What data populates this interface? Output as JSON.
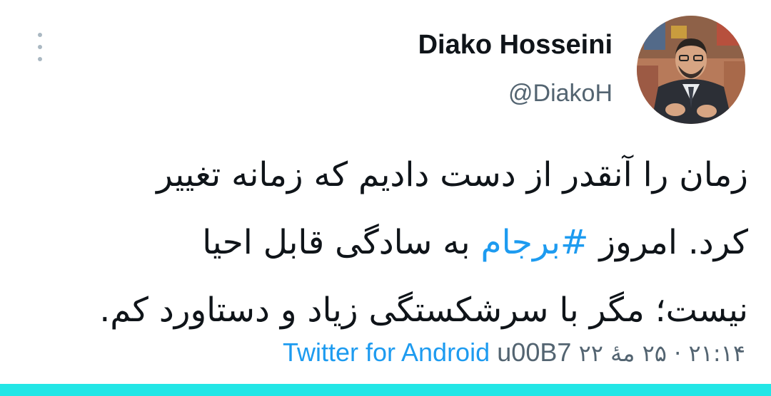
{
  "header": {
    "display_name": "Diako Hosseini",
    "handle": "@DiakoH",
    "more_icon": "more-vertical-icon"
  },
  "tweet": {
    "line1": "زمان را آنقدر از دست دادیم که زمانه تغییر",
    "line2_start": "کرد. امروز ",
    "hashtag": "#برجام",
    "line2_end": " به سادگی قابل احیا",
    "line3": "نیست؛ مگر با سرشکستگی زیاد و دستاورد کم."
  },
  "meta": {
    "time": "۲۱:۱۴",
    "dot": "·",
    "date": "۲۵ مهٔ ۲۲",
    "code": "u00B7",
    "source": "Twitter for Android"
  },
  "colors": {
    "link": "#1d9bf0",
    "secondary_text": "#536471",
    "primary_text": "#0f1419",
    "bottom_bar": "#22e6e6"
  }
}
